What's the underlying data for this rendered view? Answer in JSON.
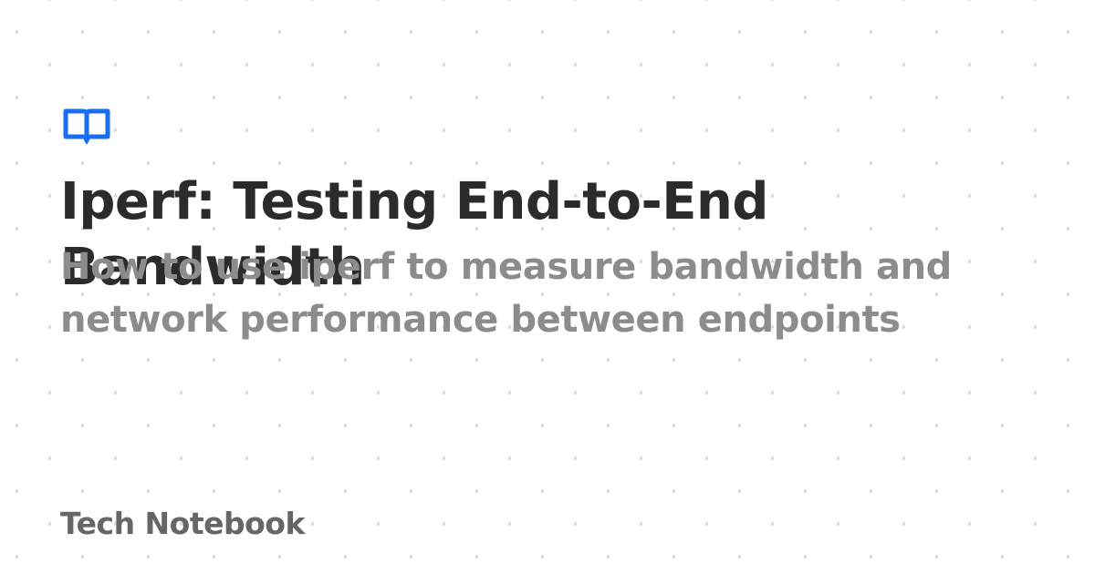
{
  "card": {
    "title": "Iperf: Testing End-to-End\nBandwidth",
    "subtitle": "How to use iperf to measure bandwidth and network performance between endpoints",
    "site_name": "Tech Notebook",
    "logo_icon": "open-book-icon"
  },
  "colors": {
    "background": "#ffffff",
    "accent": "#1a6ef2",
    "title": "#2b2b2b",
    "subtitle": "#8c8c8c",
    "site_name": "#666666",
    "pattern": "#d6d6d6"
  }
}
